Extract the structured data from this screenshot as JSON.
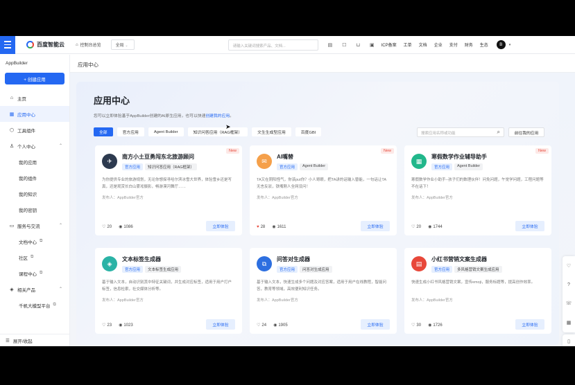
{
  "topbar": {
    "logo": "百度智能云",
    "nav_item": "控制台总览",
    "region_select": "全局",
    "search_placeholder": "请输入关键词搜索产品、文档...",
    "links": [
      "ICP备案",
      "工单",
      "文档",
      "企业",
      "支付",
      "财务",
      "生态"
    ],
    "avatar_initial": "B"
  },
  "sidebar": {
    "title": "AppBuilder",
    "create_button": "+ 创建应用",
    "items": [
      {
        "label": "主页",
        "icon": "home-icon",
        "active": false
      },
      {
        "label": "应用中心",
        "icon": "grid-icon",
        "active": true
      },
      {
        "label": "工具组件",
        "icon": "cube-icon",
        "active": false
      },
      {
        "label": "个人中心",
        "icon": "user-icon",
        "active": false,
        "expanded": true
      },
      {
        "label": "我的应用",
        "sub": true
      },
      {
        "label": "我的组件",
        "sub": true
      },
      {
        "label": "我的知识",
        "sub": true
      },
      {
        "label": "我的密钥",
        "sub": true
      },
      {
        "label": "服务与交流",
        "icon": "chat-icon",
        "active": false,
        "expanded": true
      },
      {
        "label": "文档中心",
        "sub": true,
        "external": true
      },
      {
        "label": "社区",
        "sub": true,
        "external": true
      },
      {
        "label": "课程中心",
        "sub": true,
        "external": true
      },
      {
        "label": "相关产品",
        "icon": "box-icon",
        "active": false,
        "expanded": true
      },
      {
        "label": "千帆大模型平台",
        "sub": true,
        "external": true
      }
    ],
    "collapse_label": "展开/收起"
  },
  "page_head": "应用中心",
  "panel": {
    "title": "应用中心",
    "desc_prefix": "您可以立即体验基于AppBuilder创建的AI原生应用，也可以快速",
    "desc_link": "创建我的应用",
    "desc_suffix": "。",
    "filters": [
      "全部",
      "官方应用",
      "Agent Builder",
      "知识问答应用（RAG框架）",
      "文生生成型应用",
      "百度GBI"
    ],
    "search_placeholder": "搜索应用名称或功能",
    "goto_button": "前往我的应用"
  },
  "cards": [
    {
      "name": "南方小土豆勇闯东北旅游顾问",
      "tags": [
        "官方应用",
        "知识问答应用（RAG框架）"
      ],
      "desc": "为你提供专业的旅游规划，无论你想探寻哈尔滨冰雪大世界，体验雪乡还是写真，还是观赏长白山雾凇摄影，畅游漠河舞厅……",
      "publisher": "发布人：AppBuilder官方",
      "likes": "20",
      "views": "1086",
      "is_new": true,
      "icon_color": "#2d3a4f",
      "icon_glyph": "✈",
      "liked": false
    },
    {
      "name": "AI嘴替",
      "tags": [
        "官方应用",
        "Agent Builder"
      ],
      "desc": "TA又在阴阳怪气，你该put你？小人哥眼，把TA讲的话输入替能，一句话让TA无言反驳，铁嘴刚人全网没问！",
      "publisher": "发布人：AppBuilder官方",
      "likes": "28",
      "views": "1611",
      "is_new": true,
      "icon_color": "#f5a04a",
      "icon_glyph": "✉",
      "liked": true
    },
    {
      "name": "寒假数学作业辅导助手",
      "tags": [
        "官方应用",
        "Agent Builder"
      ],
      "desc": "寒假数学作业小助手--孩子们的数理伙伴！问免问题，午觉学问题，工程问题等不在话下！",
      "publisher": "发布人：AppBuilder官方",
      "likes": "20",
      "views": "1744",
      "is_new": true,
      "icon_color": "#22b78b",
      "icon_glyph": "▦",
      "liked": false
    },
    {
      "name": "文本标签生成器",
      "tags": [
        "官方应用",
        "文本标签生成应用"
      ],
      "desc": "基于输入文本，自动识别其中特征关键词，并生成对应标签，适用于用户打户标签，信息检索，社交媒体分析等。",
      "publisher": "发布人：AppBuilder官方",
      "likes": "23",
      "views": "1023",
      "is_new": false,
      "icon_color": "#2bb3a6",
      "icon_glyph": "◈",
      "liked": false
    },
    {
      "name": "问答对生成器",
      "tags": [
        "官方应用",
        "问答对生成应用"
      ],
      "desc": "基于输入文本，快速生成多个问题及对应答案，适用于用户在线教程，智能问答，教育等领域，高效便利知识任务。",
      "publisher": "发布人：AppBuilder官方",
      "likes": "24",
      "views": "1905",
      "is_new": false,
      "icon_color": "#2d6fe0",
      "icon_glyph": "⧉",
      "liked": false
    },
    {
      "name": "小红书营销文案生成器",
      "tags": [
        "官方应用",
        "多风格营销文案生成应用"
      ],
      "desc": "快速生成小红书风格营销文案，宣传emoji，服务标题等，提高创作效率。",
      "publisher": "发布人：AppBuilder官方",
      "likes": "30",
      "views": "1726",
      "is_new": false,
      "icon_color": "#e8483a",
      "icon_glyph": "▤",
      "liked": false
    }
  ],
  "card_try_label": "立即体验"
}
